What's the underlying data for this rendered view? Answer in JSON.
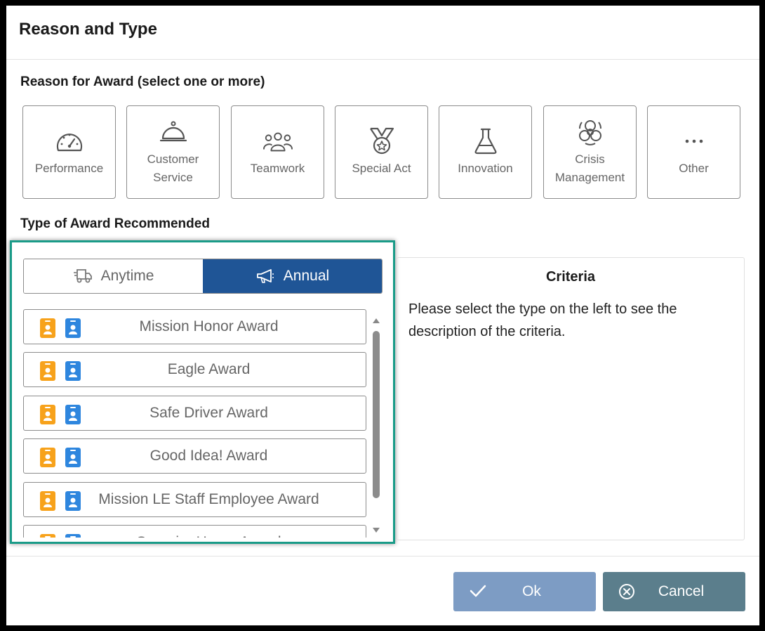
{
  "dialog": {
    "title": "Reason and Type"
  },
  "reason_section": {
    "label": "Reason for Award (select one or more)",
    "options": [
      {
        "label": "Performance",
        "icon": "gauge-icon"
      },
      {
        "label": "Customer\nService",
        "icon": "service-bell-icon"
      },
      {
        "label": "Teamwork",
        "icon": "team-icon"
      },
      {
        "label": "Special Act",
        "icon": "medal-icon"
      },
      {
        "label": "Innovation",
        "icon": "flask-icon"
      },
      {
        "label": "Crisis\nManagement",
        "icon": "biohazard-icon"
      },
      {
        "label": "Other",
        "icon": "ellipsis-icon"
      }
    ]
  },
  "type_section": {
    "label": "Type of Award Recommended",
    "toggle": {
      "anytime_label": "Anytime",
      "annual_label": "Annual",
      "selected": "Annual"
    },
    "awards": [
      {
        "name": "Mission Honor Award"
      },
      {
        "name": "Eagle Award"
      },
      {
        "name": "Safe Driver Award"
      },
      {
        "name": "Good Idea! Award"
      },
      {
        "name": "Mission LE Staff Employee Award"
      },
      {
        "name": "Superior Honor Award"
      }
    ]
  },
  "criteria": {
    "title": "Criteria",
    "text": "Please select the type on the left to see the description of the criteria."
  },
  "footer": {
    "ok_label": "Ok",
    "cancel_label": "Cancel"
  },
  "colors": {
    "accent": "#1f5596",
    "panel_highlight": "#1a9b88",
    "badge_orange": "#f7a21b",
    "badge_blue": "#2e86de",
    "ok_button": "#7d9cc4",
    "cancel_button": "#5b7e8c"
  }
}
